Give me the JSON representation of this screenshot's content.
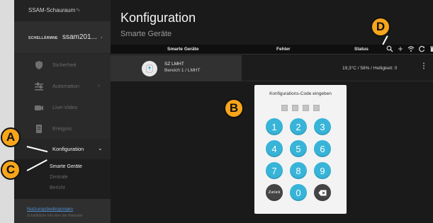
{
  "sidebar": {
    "room": "SSAM-Schauraum",
    "room_edit_icon": "pencil-icon",
    "gateway_brand": "SCHELLÄRMNE",
    "gateway_name": "ssam201...",
    "gateway_chevron": "›",
    "menu": [
      {
        "label": "Sicherheit",
        "icon": "shield-icon",
        "chevron": ""
      },
      {
        "label": "Automation",
        "icon": "sliders-icon",
        "chevron": "›"
      },
      {
        "label": "Live-Video",
        "icon": "camera-icon",
        "chevron": ""
      },
      {
        "label": "Ereignis",
        "icon": "document-icon",
        "chevron": ""
      },
      {
        "label": "Konfiguration",
        "icon": "",
        "chevron": "⌄"
      }
    ],
    "submenu": [
      "Smarte Geräte",
      "Zentrale",
      "Bericht"
    ],
    "footer": {
      "terms": "Nutzungsbedingungen",
      "terms_sub": "Schaltfläche Info über die Webseite"
    }
  },
  "main": {
    "title": "Konfiguration",
    "subtitle": "Smarte Geräte",
    "columns": [
      "Smarte Geräte",
      "Fehler",
      "Status"
    ],
    "toolbar_icons": [
      "search-icon",
      "add-icon",
      "wifi-icon",
      "refresh-icon",
      "delete-icon"
    ],
    "toolbar_symbols": [
      "+"
    ],
    "device": {
      "name": "SZ LMHT",
      "area": "Bereich 1 / LMHT",
      "status": "19,3°C / 58% / Helligkeit: 0",
      "more": "⋮"
    }
  },
  "dialog": {
    "title": "Konfigurations-Code eingeben",
    "keys": [
      "1",
      "2",
      "3",
      "4",
      "5",
      "6",
      "7",
      "8",
      "9",
      "Zurück",
      "0",
      "⌫"
    ]
  },
  "annotations": [
    "A",
    "B",
    "C",
    "D"
  ],
  "colors": {
    "accent_keypad": "#37b4d8",
    "badge": "#f7a51a",
    "background": "#1a1a1a"
  }
}
